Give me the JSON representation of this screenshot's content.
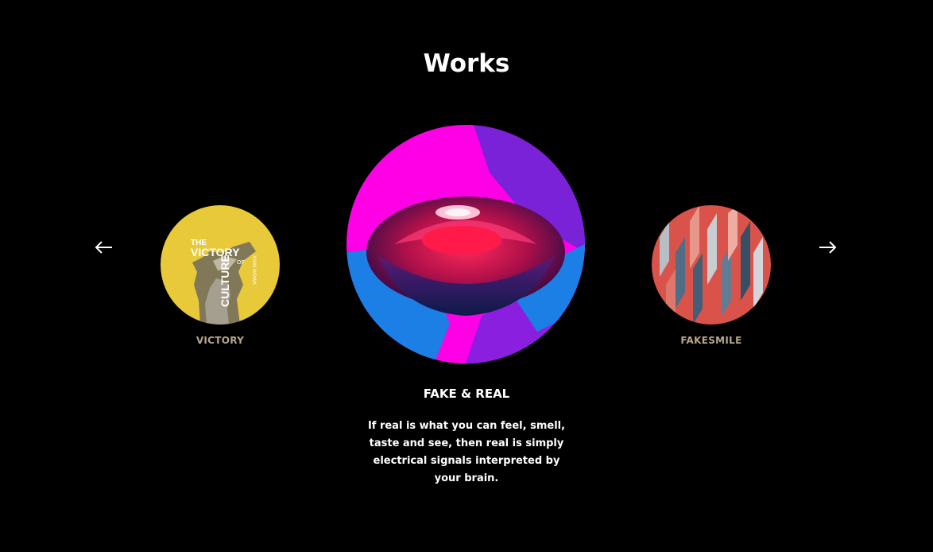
{
  "section": {
    "title": "Works"
  },
  "nav": {
    "prev_icon": "arrow-left-icon",
    "next_icon": "arrow-right-icon"
  },
  "works": [
    {
      "label": "VICTORY",
      "image_text": {
        "line1": "THE",
        "line2": "VICTORY",
        "line3": "OF",
        "line4": "CULTURE",
        "side": "JOHN WOWK"
      }
    },
    {
      "title": "FAKE & REAL",
      "description": "If real is what you can feel, smell, taste and see, then real is simply electrical signals interpreted by your brain."
    },
    {
      "label": "FAKESMILE"
    }
  ],
  "colors": {
    "background": "#000000",
    "label": "#b7a58c",
    "victory_bg": "#e8c93a",
    "magenta": "#ff00e6",
    "blue": "#1b7fe6",
    "coral": "#d9534a"
  }
}
